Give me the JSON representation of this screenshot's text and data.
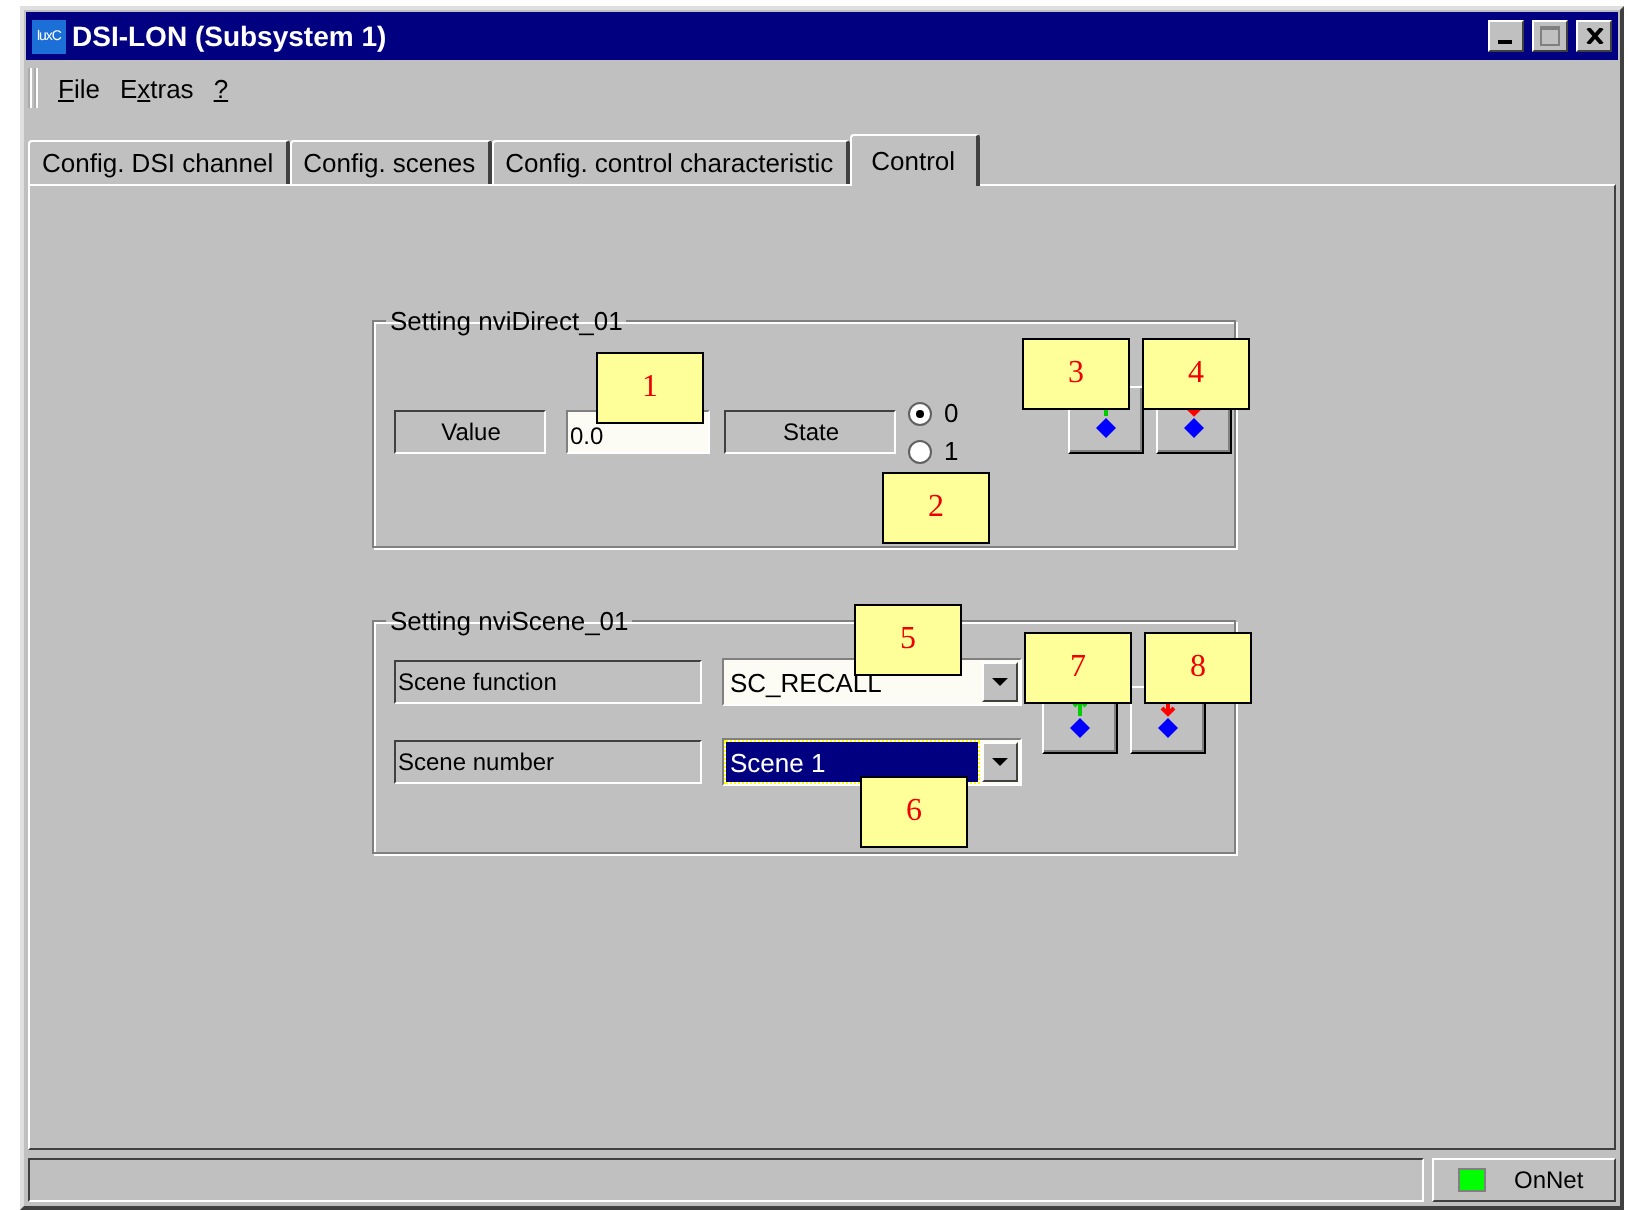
{
  "window": {
    "title": "DSI-LON (Subsystem 1)",
    "icon_text": "luxC"
  },
  "menu": [
    {
      "key": "F",
      "rest": "ile"
    },
    {
      "lead": "E",
      "key": "x",
      "rest": "tras"
    },
    {
      "key": "?"
    }
  ],
  "tabs": [
    {
      "label": "Config. DSI channel",
      "selected": false
    },
    {
      "label": "Config. scenes",
      "selected": false
    },
    {
      "label": "Config. control characteristic",
      "selected": false
    },
    {
      "label": "Control",
      "selected": true
    }
  ],
  "direct_group": {
    "title": "Setting nviDirect_01",
    "value_label": "Value",
    "value": "0.0",
    "state_label": "State",
    "radios": [
      {
        "label": "0",
        "selected": true
      },
      {
        "label": "1",
        "selected": false
      }
    ],
    "buttons": [
      {
        "kind": "raise"
      },
      {
        "kind": "lower"
      }
    ]
  },
  "scene_group": {
    "title": "Setting nviScene_01",
    "rows": [
      {
        "label": "Scene function",
        "value": "SC_RECALL",
        "selected": false
      },
      {
        "label": "Scene number",
        "value": "Scene 1",
        "selected": true
      }
    ],
    "buttons": [
      {
        "kind": "raise"
      },
      {
        "kind": "lower"
      }
    ]
  },
  "callouts": [
    "1",
    "2",
    "3",
    "4",
    "5",
    "6",
    "7",
    "8"
  ],
  "status_bar": {
    "indicator": {
      "label": "OnNet",
      "on": true
    }
  }
}
